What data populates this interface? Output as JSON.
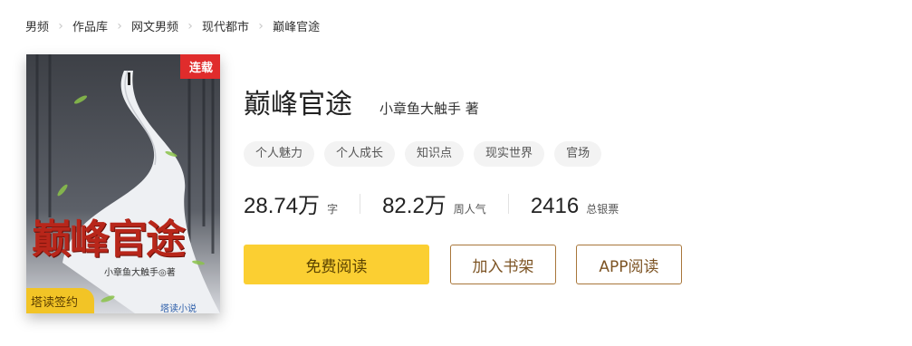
{
  "breadcrumb": [
    "男频",
    "作品库",
    "网文男频",
    "现代都市",
    "巅峰官途"
  ],
  "book": {
    "title": "巅峰官途",
    "author": "小章鱼大触手 著",
    "status_badge": "连载",
    "sign_label": "塔读签约",
    "cover_title_art": "巅峰官途",
    "cover_author": "小章鱼大触手◎著",
    "cover_publisher": "塔读小说"
  },
  "tags": [
    "个人魅力",
    "个人成长",
    "知识点",
    "现实世界",
    "官场"
  ],
  "stats": [
    {
      "value": "28.74万",
      "unit": "字"
    },
    {
      "value": "82.2万",
      "unit": "周人气"
    },
    {
      "value": "2416",
      "unit": "总银票"
    }
  ],
  "buttons": {
    "read": "免费阅读",
    "shelf": "加入书架",
    "app": "APP阅读"
  },
  "colors": {
    "accent": "#fbcf32",
    "badge": "#e02c2c",
    "outline": "#a8763a"
  }
}
